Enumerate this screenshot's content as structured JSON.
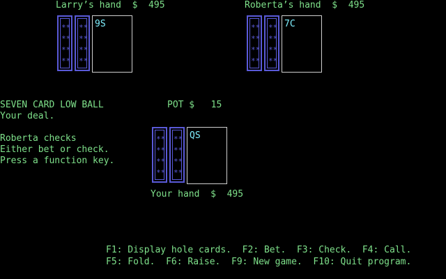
{
  "players": {
    "larry": {
      "label": "Larry’s hand  $  495",
      "card": "9S"
    },
    "roberta": {
      "label": "Roberta’s hand  $  495",
      "card": "7C"
    },
    "you": {
      "label": "Your hand  $  495",
      "card": "QS"
    }
  },
  "card_back_pattern": "**\n**\n**\n**",
  "game_title": "SEVEN CARD LOW BALL",
  "pot": "POT $   15",
  "messages": [
    "Your deal.",
    "Roberta checks",
    "Either bet or check.",
    "Press a function key."
  ],
  "function_keys": {
    "line1": "F1: Display hole cards.  F2: Bet.  F3: Check.  F4: Call.",
    "line2": "F5: Fold.  F6: Raise.  F9: New game.  F10: Quit program."
  },
  "colors": {
    "text": "#7ee08a",
    "card_back": "#5a5ad8",
    "card_rank": "#7ff0ff",
    "card_border": "#d0d0d0"
  }
}
